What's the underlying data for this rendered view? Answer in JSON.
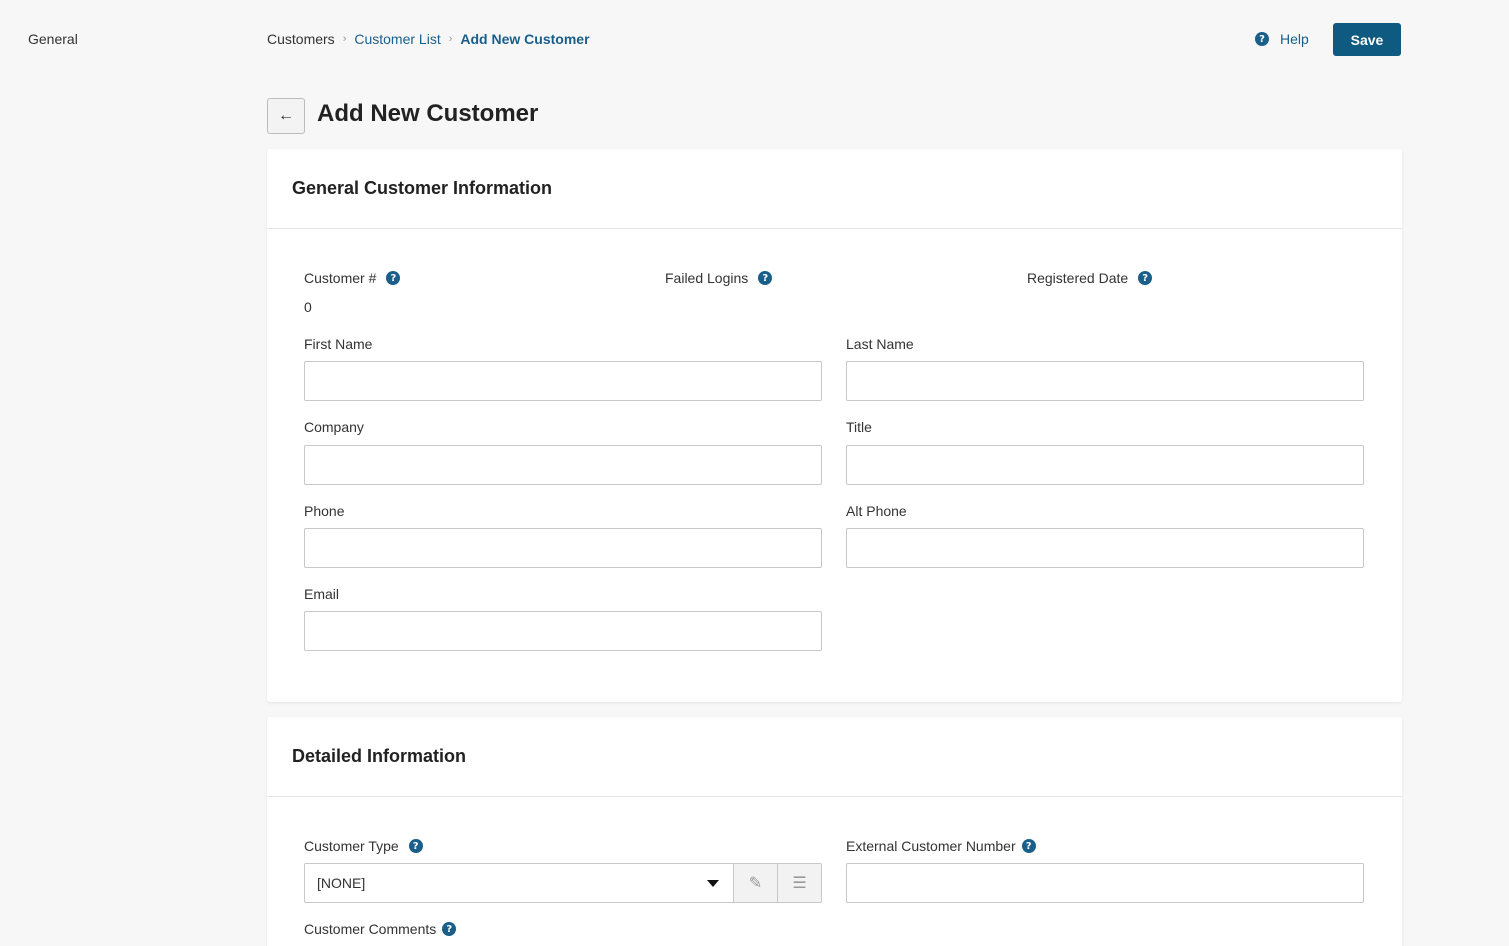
{
  "side_nav": {
    "general_label": "General"
  },
  "breadcrumb": {
    "items": [
      {
        "label": "Customers"
      },
      {
        "label": "Customer List"
      },
      {
        "label": "Add New Customer"
      }
    ]
  },
  "header": {
    "help_label": "Help",
    "save_label": "Save"
  },
  "page": {
    "title": "Add New Customer"
  },
  "general_info": {
    "title": "General Customer Information",
    "customer_number_label": "Customer #",
    "customer_number_value": "0",
    "failed_logins_label": "Failed Logins",
    "registered_date_label": "Registered Date",
    "first_name_label": "First Name",
    "last_name_label": "Last Name",
    "company_label": "Company",
    "title_label": "Title",
    "phone_label": "Phone",
    "alt_phone_label": "Alt Phone",
    "email_label": "Email"
  },
  "detailed_info": {
    "title": "Detailed Information",
    "customer_type_label": "Customer Type",
    "customer_type_value": "[NONE]",
    "external_number_label": "External Customer Number",
    "comments_label": "Customer Comments"
  },
  "icons": {
    "help": "question-circle-icon",
    "back": "arrow-left-icon",
    "edit": "pencil-icon",
    "list": "list-icon",
    "dropdown": "caret-down-icon"
  },
  "colors": {
    "accent": "#0e5a80",
    "link": "#1a5f8a"
  }
}
